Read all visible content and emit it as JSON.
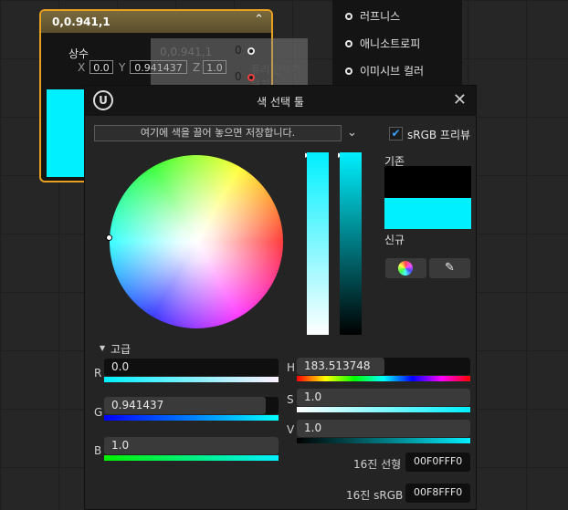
{
  "node": {
    "title": "0,0.941,1",
    "collapse_icon": "chevron-up-icon",
    "constant_label": "상수",
    "x_label": "X",
    "x_value": "0.0",
    "y_label": "Y",
    "y_value": "0.941437",
    "z_label": "Z",
    "z_value": "1.0",
    "swatch_color": "#00F0FF"
  },
  "ghost": {
    "title": "0,0.941,1",
    "output_a": "0",
    "output_b": "0",
    "preview_text": "튜리 산이기 보기"
  },
  "pins": [
    {
      "label": "러프니스"
    },
    {
      "label": "애니소트로피"
    },
    {
      "label": "이미시브 컬러"
    }
  ],
  "picker": {
    "title": "색 선택 툴",
    "logo": "U",
    "close_icon": "close-icon",
    "drop_zone_text": "여기에 색을 끌어 놓으면 저장합니다.",
    "srgb_checked": true,
    "srgb_label": "sRGB 프리뷰",
    "old_label": "기존",
    "new_label": "신규",
    "old_color": "#000000",
    "new_color": "#00F0FF",
    "advanced_label": "고급",
    "r_label": "R",
    "r_value": "0.0",
    "g_label": "G",
    "g_value": "0.941437",
    "b_label": "B",
    "b_value": "1.0",
    "h_label": "H",
    "h_value": "183.513748",
    "s_label": "S",
    "s_value": "1.0",
    "v_label": "V",
    "v_value": "1.0",
    "hex_linear_label": "16진 선형",
    "hex_linear_value": "00F0FFF0",
    "hex_srgb_label": "16진 sRGB",
    "hex_srgb_value": "00F8FFF0"
  }
}
